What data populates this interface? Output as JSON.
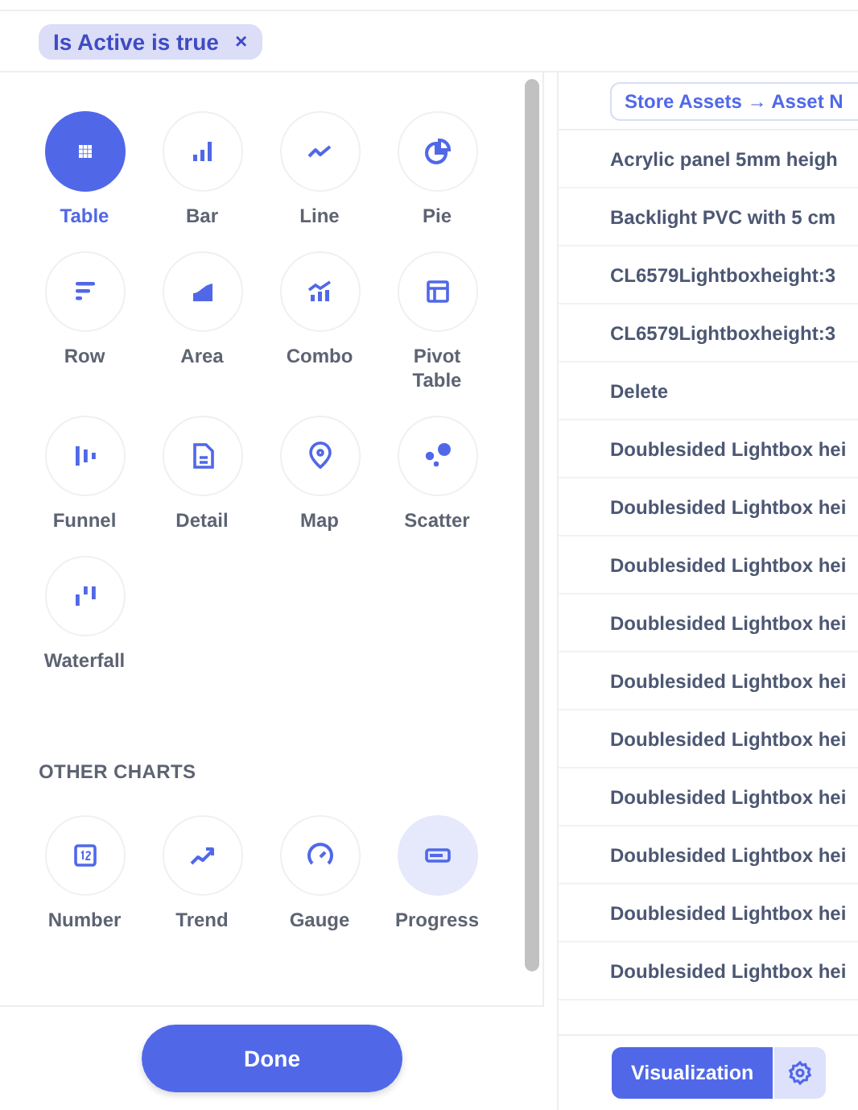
{
  "filters": [
    {
      "label": "Is Active is true",
      "remove": "×"
    }
  ],
  "chart_types": [
    {
      "label": "Table",
      "kind": "table",
      "selected": true,
      "hovered": false
    },
    {
      "label": "Bar",
      "kind": "bar",
      "selected": false,
      "hovered": false
    },
    {
      "label": "Line",
      "kind": "line",
      "selected": false,
      "hovered": false
    },
    {
      "label": "Pie",
      "kind": "pie",
      "selected": false,
      "hovered": false
    },
    {
      "label": "Row",
      "kind": "row",
      "selected": false,
      "hovered": false
    },
    {
      "label": "Area",
      "kind": "area",
      "selected": false,
      "hovered": false
    },
    {
      "label": "Combo",
      "kind": "combo",
      "selected": false,
      "hovered": false
    },
    {
      "label": "Pivot Table",
      "kind": "pivot",
      "selected": false,
      "hovered": false
    },
    {
      "label": "Funnel",
      "kind": "funnel",
      "selected": false,
      "hovered": false
    },
    {
      "label": "Detail",
      "kind": "detail",
      "selected": false,
      "hovered": false
    },
    {
      "label": "Map",
      "kind": "map",
      "selected": false,
      "hovered": false
    },
    {
      "label": "Scatter",
      "kind": "scatter",
      "selected": false,
      "hovered": false
    },
    {
      "label": "Waterfall",
      "kind": "waterfall",
      "selected": false,
      "hovered": false
    }
  ],
  "other_charts": {
    "heading": "OTHER CHARTS",
    "items": [
      {
        "label": "Number",
        "kind": "number",
        "selected": false,
        "hovered": false
      },
      {
        "label": "Trend",
        "kind": "trend",
        "selected": false,
        "hovered": false
      },
      {
        "label": "Gauge",
        "kind": "gauge",
        "selected": false,
        "hovered": false
      },
      {
        "label": "Progress",
        "kind": "progress",
        "selected": false,
        "hovered": true
      }
    ]
  },
  "done_button": "Done",
  "results": {
    "column_header": "Store Assets → Asset N",
    "rows": [
      "Acrylic panel 5mm heigh",
      "Backlight PVC with 5 cm",
      "CL6579Lightboxheight:3",
      "CL6579Lightboxheight:3",
      "Delete",
      "Doublesided Lightbox hei",
      "Doublesided Lightbox hei",
      "Doublesided Lightbox hei",
      "Doublesided Lightbox hei",
      "Doublesided Lightbox hei",
      "Doublesided Lightbox hei",
      "Doublesided Lightbox hei",
      "Doublesided Lightbox hei",
      "Doublesided Lightbox hei",
      "Doublesided Lightbox hei"
    ]
  },
  "footer": {
    "visualization_button": "Visualization"
  }
}
